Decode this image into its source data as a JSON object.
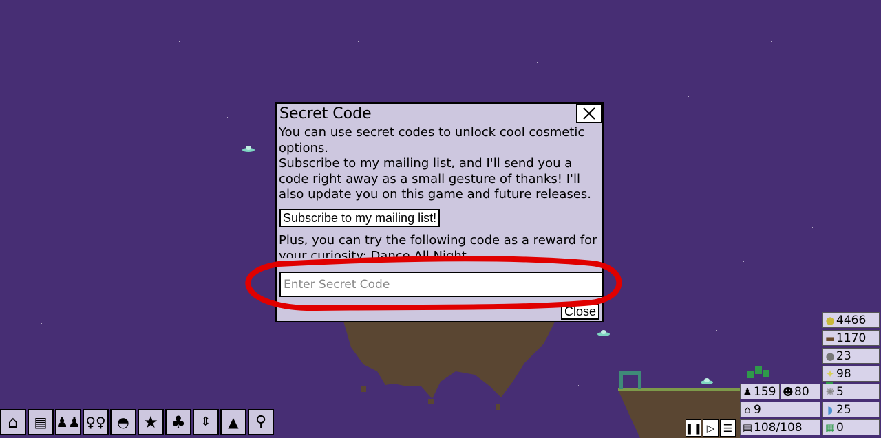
{
  "dialog": {
    "title": "Secret Code",
    "body": "You can use secret codes to unlock cool cosmetic options.\nSubscribe to my mailing list, and I'll send you a code right away as a small gesture of thanks! I'll also update you on this game and future releases.",
    "subscribe_label": "Subscribe to my mailing list!",
    "plus_text": "Plus, you can try the following code as a reward for your curiosity: Dance All Night",
    "input_placeholder": "Enter Secret Code",
    "close_label": "Close"
  },
  "resources": {
    "gold": "4466",
    "wood": "1170",
    "stone": "23",
    "knowledge": "98",
    "special": "5",
    "water": "25",
    "tech": "0"
  },
  "population": {
    "citizens": "159",
    "happiness": "80",
    "housing": "9",
    "jobs": "108/108"
  },
  "toolbar": [
    "housing-tool",
    "jobs-tool",
    "people-tool",
    "decorations-tool",
    "ufo-tool",
    "star-tool",
    "nature-tool",
    "transport-tool",
    "terrain-tool",
    "search-tool"
  ],
  "colors": {
    "sky": "#472e74",
    "ground": "#5a4632",
    "panel": "#cdc7df",
    "highlight": "#e00000"
  }
}
